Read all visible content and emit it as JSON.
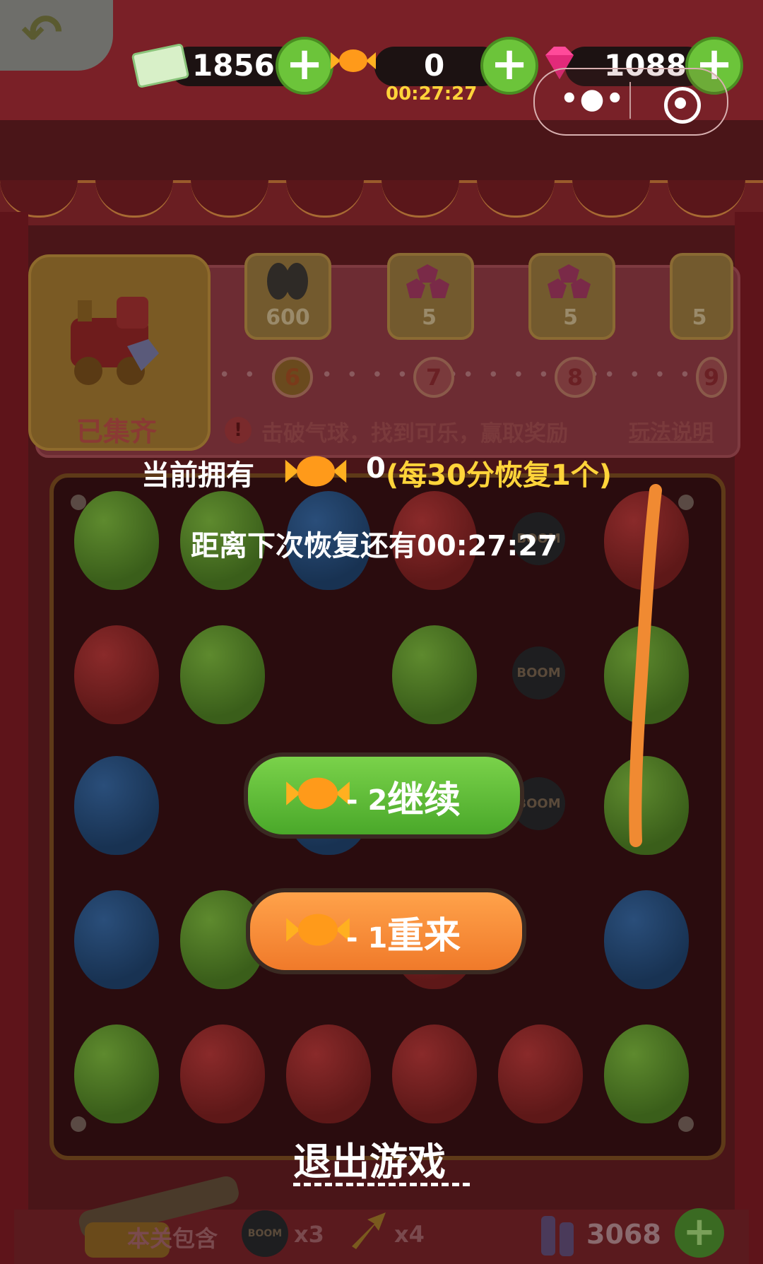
{
  "hud": {
    "tickets": "1856",
    "candies": "0",
    "candy_timer": "00:27:27",
    "gems": "1088"
  },
  "reward_track": {
    "collected_label": "已集齐",
    "items": [
      {
        "count": "600",
        "level": "6"
      },
      {
        "count": "5",
        "level": "7"
      },
      {
        "count": "5",
        "level": "8"
      },
      {
        "count": "5",
        "level": "9"
      }
    ],
    "hint_icon": "!",
    "hint": "击破气球，找到可乐，赢取奖励",
    "rules_link": "玩法说明"
  },
  "popup": {
    "own_label": "当前拥有",
    "own_count": "0",
    "own_recover": "(每30分恢复1个)",
    "next_recover": "距离下次恢复还有00:27:27",
    "continue_cost": "- 2",
    "continue_label": "继续",
    "restart_cost": "- 1",
    "restart_label": "重来",
    "exit_label": "退出游戏"
  },
  "bottom": {
    "stage_label": "本关包含",
    "bomb_count": "x3",
    "arrow_count": "x4",
    "ammo": "3068"
  },
  "board": {
    "rows": [
      [
        "green",
        "green",
        "blue",
        "red",
        "bomb",
        "red"
      ],
      [
        "red",
        "green",
        "empty",
        "green",
        "bomb",
        "green"
      ],
      [
        "blue",
        "empty",
        "blue",
        "empty",
        "bomb",
        "green"
      ],
      [
        "blue",
        "green",
        "empty",
        "red",
        "empty",
        "blue"
      ],
      [
        "green",
        "red",
        "red",
        "red",
        "red",
        "green"
      ]
    ],
    "bomb_text": "BOOM"
  },
  "icons": {
    "back": "back-arrow-icon",
    "ticket": "ticket-icon",
    "candy": "candy-icon",
    "gem": "gem-icon",
    "plus": "plus-icon",
    "more": "more-dots-icon",
    "close": "target-circle-icon"
  },
  "colors": {
    "candy": "#ffb020",
    "timer": "#ffd43a",
    "continue": "#5cbf34",
    "restart": "#f48a34",
    "stroke": "#f08a32"
  }
}
